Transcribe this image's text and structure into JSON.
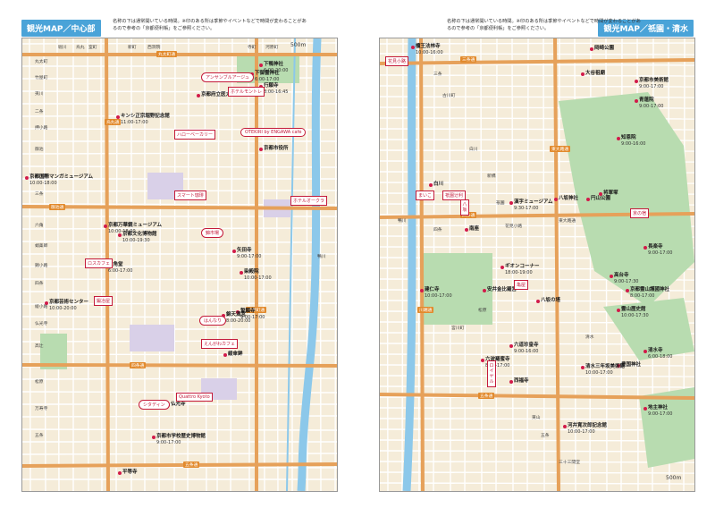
{
  "pages": {
    "left": {
      "title": "観光MAP／中心部",
      "note": "名称の下は通常開いている時間。※印のある所は季節やイベントなどで時間が変わることがあるので参考の「京都便利帳」をご参照ください。",
      "scale": "500m",
      "pois": [
        {
          "name": "下鴨神社",
          "hours": "6:00-20:00"
        },
        {
          "name": "下御霊神社",
          "hours": "6:00-17:00"
        },
        {
          "name": "行願寺",
          "hours": "8:00-16:45"
        },
        {
          "name": "キンシ正宗堀野記念館",
          "hours": "11:00-17:00"
        },
        {
          "name": "京都文化博物館",
          "hours": "10:00-19:30"
        },
        {
          "name": "京都国際マンガミュージアム",
          "hours": "10:00-18:00"
        },
        {
          "name": "京都市役所",
          "hours": ""
        },
        {
          "name": "京都万華鏡ミュージアム",
          "hours": "10:00-18:00"
        },
        {
          "name": "六角堂",
          "hours": "6:00-17:00"
        },
        {
          "name": "京都芸術センター",
          "hours": "10:00-20:00"
        },
        {
          "name": "矢田寺",
          "hours": "9:00-17:00"
        },
        {
          "name": "誓願寺",
          "hours": "9:00-17:00"
        },
        {
          "name": "錦天満宮",
          "hours": "8:00-20:00"
        },
        {
          "name": "染殿院",
          "hours": "10:00-17:00"
        },
        {
          "name": "仏光寺",
          "hours": ""
        },
        {
          "name": "綾傘鉾",
          "hours": ""
        },
        {
          "name": "京都市学校歴史博物館",
          "hours": "9:00-17:00"
        },
        {
          "name": "平等寺",
          "hours": ""
        },
        {
          "name": "京都府立医大",
          "hours": ""
        }
      ],
      "tags": [
        "アンサンブルアージュ",
        "ホテルモントレ",
        "ハローベーカリー",
        "OTEKIRI by ENGAWA cafe",
        "ホテルオークラ",
        "スマート珈琲",
        "はんなり",
        "えんがわカフェ",
        "Quattro Kyoto",
        "シタディン",
        "ロスカフェ",
        "鍛冶屋",
        "錦市場"
      ],
      "places": [
        "丸太町",
        "竹屋町",
        "夷川",
        "二条",
        "押小路",
        "御池",
        "姉小路",
        "三条",
        "六角",
        "蛸薬師",
        "錦小路",
        "四条",
        "綾小路",
        "仏光寺",
        "高辻",
        "松原",
        "万寿寺",
        "五条",
        "烏丸",
        "室町",
        "新町",
        "西洞院",
        "堀川",
        "河原町",
        "寺町",
        "鴨川",
        "高瀬川"
      ],
      "roads": [
        "丸太町通",
        "烏丸通",
        "四条通",
        "河原町通",
        "御池通",
        "五条通"
      ]
    },
    "right": {
      "title": "観光MAP／祇園・清水",
      "note": "名称の下は通常開いている時間。※印のある所は季節やイベントなどで時間が変わることがあるので参考の「京都便利帳」をご参照ください。",
      "scale": "500m",
      "pois": [
        {
          "name": "檀王法林寺",
          "hours": "10:00-16:00"
        },
        {
          "name": "岡崎公園",
          "hours": ""
        },
        {
          "name": "大谷祖廟",
          "hours": ""
        },
        {
          "name": "知恩院",
          "hours": "9:00-16:00"
        },
        {
          "name": "青蓮院",
          "hours": "9:00-17:00"
        },
        {
          "name": "将軍塚",
          "hours": ""
        },
        {
          "name": "円山公園",
          "hours": ""
        },
        {
          "name": "八坂神社",
          "hours": ""
        },
        {
          "name": "長楽寺",
          "hours": "9:00-17:00"
        },
        {
          "name": "高台寺",
          "hours": "9:00-17:30"
        },
        {
          "name": "京都霊山護國神社",
          "hours": "8:00-17:00"
        },
        {
          "name": "霊山歴史館",
          "hours": "10:00-17:30"
        },
        {
          "name": "清水寺",
          "hours": "6:00-18:00"
        },
        {
          "name": "地主神社",
          "hours": "9:00-17:00"
        },
        {
          "name": "六波羅蜜寺",
          "hours": "8:00-17:00"
        },
        {
          "name": "建仁寺",
          "hours": "10:00-17:00"
        },
        {
          "name": "安井金比羅宮",
          "hours": ""
        },
        {
          "name": "八坂の塔",
          "hours": ""
        },
        {
          "name": "六道珍皇寺",
          "hours": "9:00-16:00"
        },
        {
          "name": "西福寺",
          "hours": ""
        },
        {
          "name": "豊国神社",
          "hours": ""
        },
        {
          "name": "河井寛次郎記念館",
          "hours": "10:00-17:00"
        },
        {
          "name": "京都市美術館",
          "hours": "9:00-17:00"
        },
        {
          "name": "南座",
          "hours": ""
        },
        {
          "name": "ギオンコーナー",
          "hours": "18:00-19:00"
        },
        {
          "name": "漢字ミュージアム",
          "hours": "9:30-17:00"
        },
        {
          "name": "清水三年坂美術館",
          "hours": "10:00-17:00"
        },
        {
          "name": "白川",
          "hours": ""
        }
      ],
      "tags": [
        "花見小路",
        "まいこ",
        "祇園辻利",
        "八坂",
        "ロイヤル",
        "京の宿",
        "亀屋"
      ],
      "places": [
        "三条",
        "古川町",
        "白川",
        "新橋",
        "祇園",
        "四条",
        "花見小路",
        "宮川町",
        "松原",
        "東山",
        "清水",
        "五条",
        "三十三間堂",
        "鴨川",
        "東大路通"
      ],
      "roads": [
        "三条通",
        "四条通",
        "東大路通",
        "五条通",
        "川端通"
      ]
    }
  },
  "colors": {
    "title_bg": "#4aa3d8",
    "map_bg": "#f5ecd9",
    "street": "#ffffff",
    "main_road": "#e6a15a",
    "river": "#8cc8ea",
    "park": "#b8dcb0",
    "accent": "#c41a3a"
  }
}
